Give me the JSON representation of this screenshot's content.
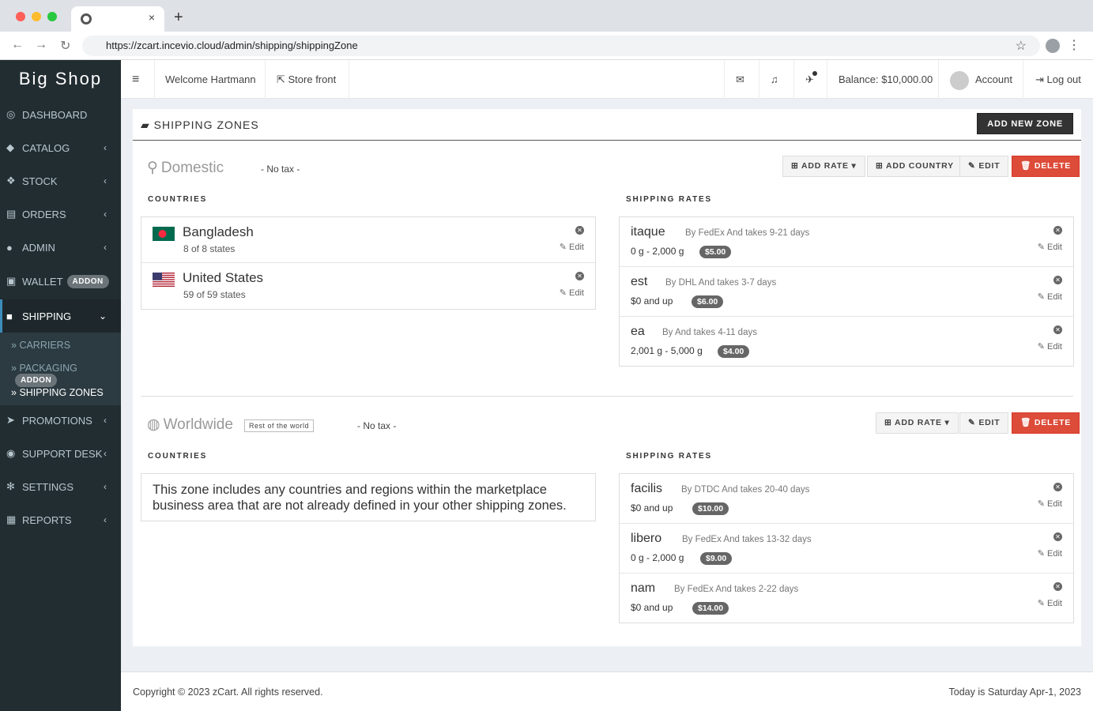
{
  "browser": {
    "url": "https://zcart.incevio.cloud/admin/shipping/shippingZone",
    "close": "×",
    "new_tab": "+",
    "back": "←",
    "forward": "→",
    "reload": "↻",
    "star": "☆",
    "menu": "⋮"
  },
  "sidebar": {
    "logo": "Big Shop",
    "items": [
      {
        "label": "DASHBOARD",
        "icon": "dashboard-icon"
      },
      {
        "label": "CATALOG",
        "icon": "tag-icon"
      },
      {
        "label": "STOCK",
        "icon": "cubes-icon"
      },
      {
        "label": "ORDERS",
        "icon": "cart-icon"
      },
      {
        "label": "ADMIN",
        "icon": "user-secret-icon"
      },
      {
        "label": "WALLET",
        "icon": "money-icon",
        "badge": "ADDON"
      },
      {
        "label": "SHIPPING",
        "icon": "truck-icon"
      },
      {
        "label": "PROMOTIONS",
        "icon": "paper-plane-icon"
      },
      {
        "label": "SUPPORT DESK",
        "icon": "life-ring-icon"
      },
      {
        "label": "SETTINGS",
        "icon": "cogs-icon"
      },
      {
        "label": "REPORTS",
        "icon": "map-icon"
      }
    ],
    "submenu": [
      {
        "label": "CARRIERS"
      },
      {
        "label": "PACKAGING",
        "badge": "ADDON"
      },
      {
        "label": "SHIPPING ZONES"
      }
    ]
  },
  "topbar": {
    "welcome": "Welcome Hartmann",
    "store_front": "Store front",
    "balance": "Balance: $10,000.00",
    "account": "Account",
    "logout": "Log out"
  },
  "page": {
    "title": "SHIPPING ZONES",
    "add_zone": "ADD NEW ZONE",
    "countries_label": "COUNTRIES",
    "rates_label": "SHIPPING RATES",
    "btn_add_rate": "ADD RATE",
    "btn_add_country": "ADD COUNTRY",
    "btn_edit": "EDIT",
    "btn_delete": "DELETE",
    "edit_link": "Edit"
  },
  "zones": [
    {
      "name": "Domestic",
      "tax": "- No tax -",
      "countries": [
        {
          "name": "Bangladesh",
          "states": "8 of 8 states"
        },
        {
          "name": "United States",
          "states": "59 of 59 states"
        }
      ],
      "rates": [
        {
          "name": "itaque",
          "desc": "By FedEx And takes 9-21 days",
          "range": "0 g - 2,000 g",
          "price": "$5.00"
        },
        {
          "name": "est",
          "desc": "By DHL And takes 3-7 days",
          "range": "$0 and up",
          "price": "$6.00"
        },
        {
          "name": "ea",
          "desc": "By And takes 4-11 days",
          "range": "2,001 g - 5,000 g",
          "price": "$4.00"
        }
      ]
    },
    {
      "name": "Worldwide",
      "tag": "Rest of the world",
      "tax": "- No tax -",
      "note": "This zone includes any countries and regions within the marketplace business area that are not already defined in your other shipping zones.",
      "rates": [
        {
          "name": "facilis",
          "desc": "By DTDC And takes 20-40 days",
          "range": "$0 and up",
          "price": "$10.00"
        },
        {
          "name": "libero",
          "desc": "By FedEx And takes 13-32 days",
          "range": "0 g - 2,000 g",
          "price": "$9.00"
        },
        {
          "name": "nam",
          "desc": "By FedEx And takes 2-22 days",
          "range": "$0 and up",
          "price": "$14.00"
        }
      ]
    }
  ],
  "footer": {
    "copyright": "Copyright © 2023 zCart. All rights reserved.",
    "date": "Today is Saturday Apr-1, 2023"
  },
  "colors": {
    "sidebar": "#222d32",
    "danger": "#dd4b39",
    "accent": "#3c8dbc"
  }
}
